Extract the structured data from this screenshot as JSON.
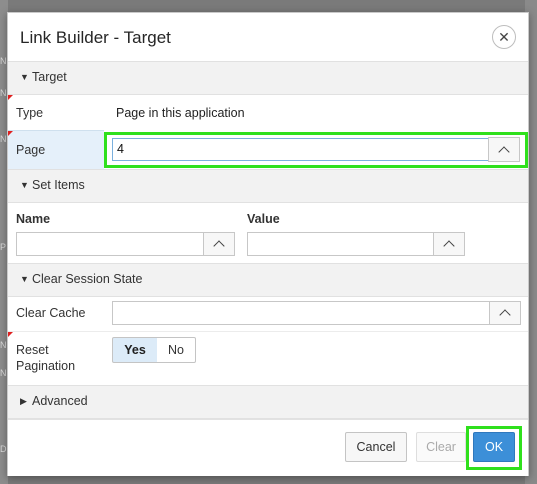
{
  "dialog": {
    "title": "Link Builder - Target",
    "close_icon": "close-icon"
  },
  "background": {
    "ticks": [
      "N",
      "N",
      "N",
      "P",
      "N",
      "N",
      "D"
    ]
  },
  "target_section": {
    "label": "Target",
    "type_label": "Type",
    "type_value": "Page in this application",
    "page_label": "Page",
    "page_value": "4"
  },
  "set_items_section": {
    "label": "Set Items",
    "name_header": "Name",
    "value_header": "Value",
    "name_value": "",
    "value_value": ""
  },
  "clear_session_section": {
    "label": "Clear Session State",
    "clear_cache_label": "Clear Cache",
    "clear_cache_value": "",
    "reset_pagination_label_line1": "Reset",
    "reset_pagination_label_line2": "Pagination",
    "options": [
      "Yes",
      "No"
    ],
    "selected": "Yes"
  },
  "advanced_section": {
    "label": "Advanced"
  },
  "footer": {
    "cancel_label": "Cancel",
    "clear_label": "Clear",
    "ok_label": "OK"
  },
  "colors": {
    "highlight": "#2fe01c",
    "ok_button": "#3c8fd8",
    "selected_option": "#dcebf8",
    "required_marker": "#e02020"
  }
}
